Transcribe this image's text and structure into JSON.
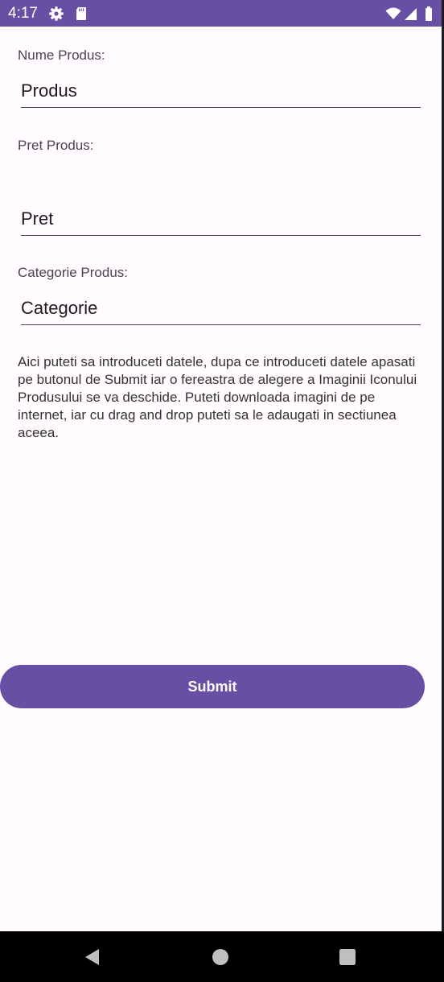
{
  "status_bar": {
    "time": "4:17",
    "left_icons": [
      "gear-icon",
      "sd-card-icon"
    ],
    "right_icons": [
      "wifi-icon",
      "signal-icon",
      "battery-icon"
    ],
    "color": "#6750a4"
  },
  "form": {
    "name": {
      "label": "Nume Produs:",
      "placeholder": "Produs",
      "value": ""
    },
    "price": {
      "label": "Pret Produs:",
      "placeholder": "Pret",
      "value": ""
    },
    "category": {
      "label": "Categorie Produs:",
      "placeholder": "Categorie",
      "value": ""
    }
  },
  "help_text": "Aici puteti sa introduceti datele, dupa ce introduceti datele apasati pe butonul de Submit iar o fereastra de alegere a Imaginii Iconului Produsului se va deschide. Puteti downloada imagini de pe internet, iar cu drag and drop puteti sa le adaugati in sectiunea aceea.",
  "submit": {
    "label": "Submit"
  },
  "nav_bar": {
    "buttons": [
      "back-icon",
      "home-icon",
      "recents-icon"
    ]
  },
  "colors": {
    "accent": "#6750a4",
    "background": "#fffbfe",
    "text": "#1c1b1f"
  }
}
